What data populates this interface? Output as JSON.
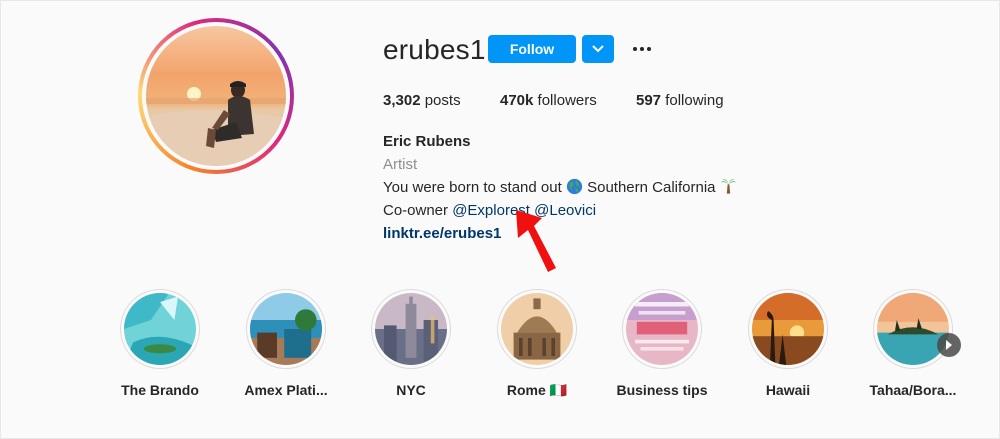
{
  "profile": {
    "username": "erubes1",
    "follow_label": "Follow",
    "stats": {
      "posts_count": "3,302",
      "posts_label": "posts",
      "followers_count": "470k",
      "followers_label": "followers",
      "following_count": "597",
      "following_label": "following"
    },
    "bio": {
      "name": "Eric Rubens",
      "category": "Artist",
      "line1_text": "You were born to stand out",
      "line1_location": "Southern California",
      "line2_prefix": "Co-owner",
      "mention1": "@Explorest",
      "mention2": "@Leovici",
      "link": "linktr.ee/erubes1"
    }
  },
  "highlights": [
    {
      "label": "The Brando"
    },
    {
      "label": "Amex Plati..."
    },
    {
      "label": "NYC"
    },
    {
      "label": "Rome 🇮🇹"
    },
    {
      "label": "Business tips"
    },
    {
      "label": "Hawaii"
    },
    {
      "label": "Tahaa/Bora..."
    }
  ],
  "colors": {
    "follow_button": "#0095f6",
    "link": "#00376b",
    "annotation_arrow": "#ff0000"
  },
  "icons": [
    "chevron-down-icon",
    "more-options-icon",
    "globe-icon",
    "palm-tree-icon",
    "next-arrow-icon"
  ]
}
